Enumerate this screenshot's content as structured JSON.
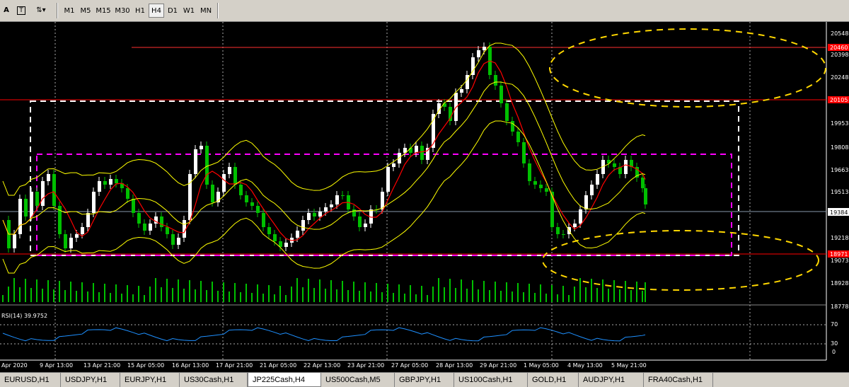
{
  "toolbar": {
    "items": [
      {
        "name": "text-tool-button",
        "label": "A",
        "x": 5
      },
      {
        "name": "text-label-tool-button",
        "label": "T",
        "x": 26
      }
    ],
    "timeframes": [
      "M1",
      "M5",
      "M15",
      "M30",
      "H1",
      "H4",
      "D1",
      "W1",
      "MN"
    ],
    "active_timeframe": "H4"
  },
  "chart": {
    "symbol": "JP225Cash,H4",
    "indicator_label": "RSI(14) 39.9752",
    "price_labels": [
      "20548",
      "20398",
      "20248",
      "19953",
      "19808",
      "19663",
      "19513",
      "19218",
      "19073",
      "18928",
      "18778"
    ],
    "highlight_labels": {
      "line1": "20460",
      "line2": "20105",
      "current": "19384",
      "line3": "18971"
    },
    "rsi_labels": [
      "70",
      "30",
      "0"
    ],
    "time_labels": [
      "Apr 2020",
      "9 Apr 13:00",
      "13 Apr 21:00",
      "15 Apr 05:00",
      "16 Apr 13:00",
      "17 Apr 21:00",
      "21 Apr 05:00",
      "22 Apr 13:00",
      "23 Apr 21:00",
      "27 Apr 05:00",
      "28 Apr 13:00",
      "29 Apr 21:00",
      "1 May 05:00",
      "4 May 13:00",
      "5 May 21:00"
    ]
  },
  "colors": {
    "background": "#000000",
    "bull": "#ffffff",
    "bear": "#00c000",
    "volume": "#00c000",
    "ma_red": "#ff0000",
    "bands": "#ffff00",
    "rsi": "#1e90ff",
    "magenta": "#ff00ff",
    "highlight": "#ff0000"
  },
  "tabs": [
    "EURUSD,H1",
    "USDJPY,H1",
    "EURJPY,H1",
    "US30Cash,H1",
    "JP225Cash,H4",
    "US500Cash,M5",
    "GBPJPY,H1",
    "US100Cash,H1",
    "GOLD,H1",
    "AUDJPY,H1",
    "FRA40Cash,H1"
  ],
  "active_tab": "JP225Cash,H4"
}
